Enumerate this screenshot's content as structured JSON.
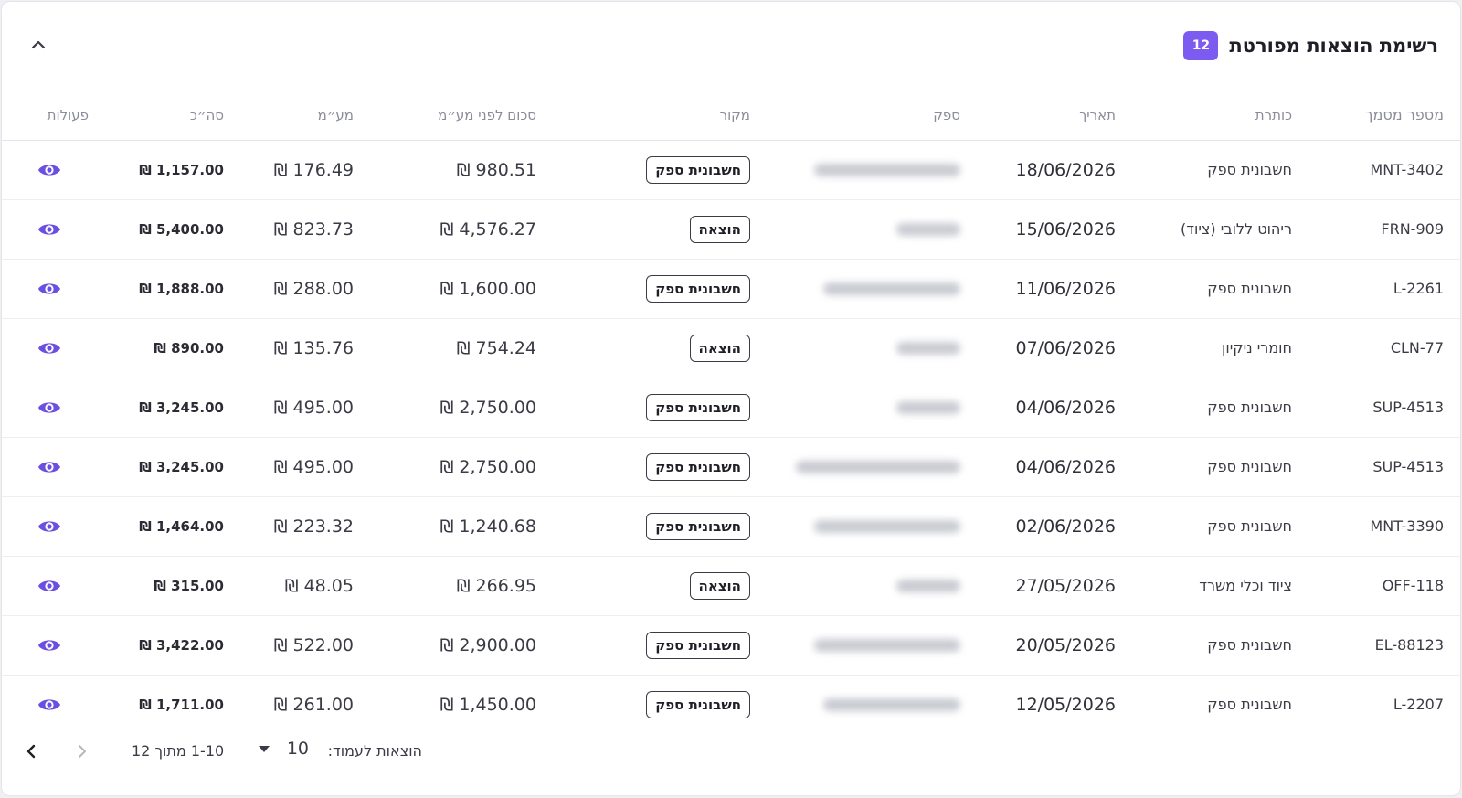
{
  "header": {
    "title": "רשימת הוצאות מפורטת",
    "count": "12"
  },
  "columns": {
    "doc_number": "מספר מסמך",
    "title": "כותרת",
    "date": "תאריך",
    "supplier": "ספק",
    "source": "מקור",
    "amount_before_vat": "סכום לפני מע״מ",
    "vat": "מע״מ",
    "total": "סה״כ",
    "actions": "פעולות"
  },
  "rows": [
    {
      "doc": "MNT-3402",
      "title": "חשבונית ספק",
      "date": "18/06/2026",
      "source": "חשבונית ספק",
      "net": "₪ 980.51",
      "vat": "₪ 176.49",
      "total": "₪ 1,157.00"
    },
    {
      "doc": "FRN-909",
      "title": "ריהוט ללובי (ציוד)",
      "date": "15/06/2026",
      "source": "הוצאה",
      "net": "₪ 4,576.27",
      "vat": "₪ 823.73",
      "total": "₪ 5,400.00"
    },
    {
      "doc": "L-2261",
      "title": "חשבונית ספק",
      "date": "11/06/2026",
      "source": "חשבונית ספק",
      "net": "₪ 1,600.00",
      "vat": "₪ 288.00",
      "total": "₪ 1,888.00"
    },
    {
      "doc": "CLN-77",
      "title": "חומרי ניקיון",
      "date": "07/06/2026",
      "source": "הוצאה",
      "net": "₪ 754.24",
      "vat": "₪ 135.76",
      "total": "₪ 890.00"
    },
    {
      "doc": "SUP-4513",
      "title": "חשבונית ספק",
      "date": "04/06/2026",
      "source": "חשבונית ספק",
      "net": "₪ 2,750.00",
      "vat": "₪ 495.00",
      "total": "₪ 3,245.00"
    },
    {
      "doc": "SUP-4513",
      "title": "חשבונית ספק",
      "date": "04/06/2026",
      "source": "חשבונית ספק",
      "net": "₪ 2,750.00",
      "vat": "₪ 495.00",
      "total": "₪ 3,245.00"
    },
    {
      "doc": "MNT-3390",
      "title": "חשבונית ספק",
      "date": "02/06/2026",
      "source": "חשבונית ספק",
      "net": "₪ 1,240.68",
      "vat": "₪ 223.32",
      "total": "₪ 1,464.00"
    },
    {
      "doc": "OFF-118",
      "title": "ציוד וכלי משרד",
      "date": "27/05/2026",
      "source": "הוצאה",
      "net": "₪ 266.95",
      "vat": "₪ 48.05",
      "total": "₪ 315.00"
    },
    {
      "doc": "EL-88123",
      "title": "חשבונית ספק",
      "date": "20/05/2026",
      "source": "חשבונית ספק",
      "net": "₪ 2,900.00",
      "vat": "₪ 522.00",
      "total": "₪ 3,422.00"
    },
    {
      "doc": "L-2207",
      "title": "חשבונית ספק",
      "date": "12/05/2026",
      "source": "חשבונית ספק",
      "net": "₪ 1,450.00",
      "vat": "₪ 261.00",
      "total": "₪ 1,711.00"
    }
  ],
  "footer": {
    "rows_per_page_label": "הוצאות לעמוד:",
    "rows_per_page_value": "10",
    "range": "1-10 מתוך 12"
  },
  "icons": {
    "collapse": "chevron-up-icon",
    "view": "eye-icon",
    "dropdown": "caret-down-icon",
    "prev": "chevron-right-icon",
    "next": "chevron-left-icon"
  },
  "colors": {
    "accent": "#7c5cf0",
    "eye": "#6b4fe0"
  }
}
